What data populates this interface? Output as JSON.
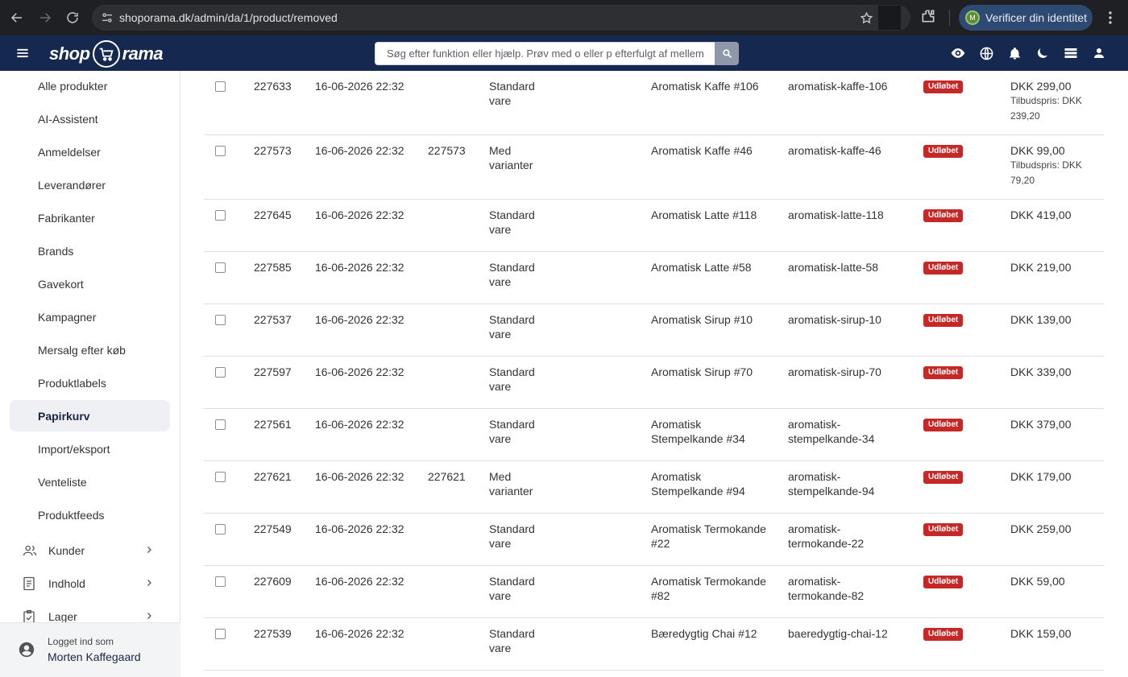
{
  "browser": {
    "url": "shoporama.dk/admin/da/1/product/removed",
    "profile_initial": "M",
    "profile_button_label": "Verificer din identitet"
  },
  "header": {
    "logo_text_left": "shop",
    "logo_text_right": "rama",
    "search_placeholder": "Søg efter funktion eller hjælp. Prøv med o eller p efterfulgt af mellemrum",
    "brand_color": "#142850"
  },
  "sidebar": {
    "items": [
      {
        "label": "Alle produkter"
      },
      {
        "label": "AI-Assistent"
      },
      {
        "label": "Anmeldelser"
      },
      {
        "label": "Leverandører"
      },
      {
        "label": "Fabrikanter"
      },
      {
        "label": "Brands"
      },
      {
        "label": "Gavekort"
      },
      {
        "label": "Kampagner"
      },
      {
        "label": "Mersalg efter køb"
      },
      {
        "label": "Produktlabels"
      },
      {
        "label": "Papirkurv"
      },
      {
        "label": "Import/eksport"
      },
      {
        "label": "Venteliste"
      },
      {
        "label": "Produktfeeds"
      }
    ],
    "active_item": "Papirkurv",
    "groups": [
      {
        "label": "Kunder",
        "icon": "people-icon"
      },
      {
        "label": "Indhold",
        "icon": "document-icon"
      },
      {
        "label": "Lager",
        "icon": "clipboard-icon"
      }
    ],
    "user": {
      "caption": "Logget ind som",
      "name": "Morten Kaffegaard"
    }
  },
  "table": {
    "rows": [
      {
        "id": "227633",
        "date": "16-06-2026 22:32",
        "sku": "",
        "type": [
          "Standard",
          "vare"
        ],
        "name": [
          "Aromatisk Kaffe #106"
        ],
        "slug": [
          "aromatisk-kaffe-106"
        ],
        "status": "Udløbet",
        "price": "DKK 299,00",
        "offer": [
          "Tilbudspris: DKK",
          "239,20"
        ]
      },
      {
        "id": "227573",
        "date": "16-06-2026 22:32",
        "sku": "227573",
        "type": [
          "Med",
          "varianter"
        ],
        "name": [
          "Aromatisk Kaffe #46"
        ],
        "slug": [
          "aromatisk-kaffe-46"
        ],
        "status": "Udløbet",
        "price": "DKK 99,00",
        "offer": [
          "Tilbudspris: DKK",
          "79,20"
        ]
      },
      {
        "id": "227645",
        "date": "16-06-2026 22:32",
        "sku": "",
        "type": [
          "Standard",
          "vare"
        ],
        "name": [
          "Aromatisk Latte #118"
        ],
        "slug": [
          "aromatisk-latte-118"
        ],
        "status": "Udløbet",
        "price": "DKK 419,00",
        "offer": []
      },
      {
        "id": "227585",
        "date": "16-06-2026 22:32",
        "sku": "",
        "type": [
          "Standard",
          "vare"
        ],
        "name": [
          "Aromatisk Latte #58"
        ],
        "slug": [
          "aromatisk-latte-58"
        ],
        "status": "Udløbet",
        "price": "DKK 219,00",
        "offer": []
      },
      {
        "id": "227537",
        "date": "16-06-2026 22:32",
        "sku": "",
        "type": [
          "Standard",
          "vare"
        ],
        "name": [
          "Aromatisk Sirup #10"
        ],
        "slug": [
          "aromatisk-sirup-10"
        ],
        "status": "Udløbet",
        "price": "DKK 139,00",
        "offer": []
      },
      {
        "id": "227597",
        "date": "16-06-2026 22:32",
        "sku": "",
        "type": [
          "Standard",
          "vare"
        ],
        "name": [
          "Aromatisk Sirup #70"
        ],
        "slug": [
          "aromatisk-sirup-70"
        ],
        "status": "Udløbet",
        "price": "DKK 339,00",
        "offer": []
      },
      {
        "id": "227561",
        "date": "16-06-2026 22:32",
        "sku": "",
        "type": [
          "Standard",
          "vare"
        ],
        "name": [
          "Aromatisk",
          "Stempelkande #34"
        ],
        "slug": [
          "aromatisk-",
          "stempelkande-34"
        ],
        "status": "Udløbet",
        "price": "DKK 379,00",
        "offer": []
      },
      {
        "id": "227621",
        "date": "16-06-2026 22:32",
        "sku": "227621",
        "type": [
          "Med",
          "varianter"
        ],
        "name": [
          "Aromatisk",
          "Stempelkande #94"
        ],
        "slug": [
          "aromatisk-",
          "stempelkande-94"
        ],
        "status": "Udløbet",
        "price": "DKK 179,00",
        "offer": []
      },
      {
        "id": "227549",
        "date": "16-06-2026 22:32",
        "sku": "",
        "type": [
          "Standard",
          "vare"
        ],
        "name": [
          "Aromatisk Termokande",
          "#22"
        ],
        "slug": [
          "aromatisk-",
          "termokande-22"
        ],
        "status": "Udløbet",
        "price": "DKK 259,00",
        "offer": []
      },
      {
        "id": "227609",
        "date": "16-06-2026 22:32",
        "sku": "",
        "type": [
          "Standard",
          "vare"
        ],
        "name": [
          "Aromatisk Termokande",
          "#82"
        ],
        "slug": [
          "aromatisk-",
          "termokande-82"
        ],
        "status": "Udløbet",
        "price": "DKK 59,00",
        "offer": []
      },
      {
        "id": "227539",
        "date": "16-06-2026 22:32",
        "sku": "",
        "type": [
          "Standard",
          "vare"
        ],
        "name": [
          "Bæredygtig Chai #12"
        ],
        "slug": [
          "baeredygtig-chai-12"
        ],
        "status": "Udløbet",
        "price": "DKK 159,00",
        "offer": []
      }
    ],
    "status_color": "#c62828"
  }
}
